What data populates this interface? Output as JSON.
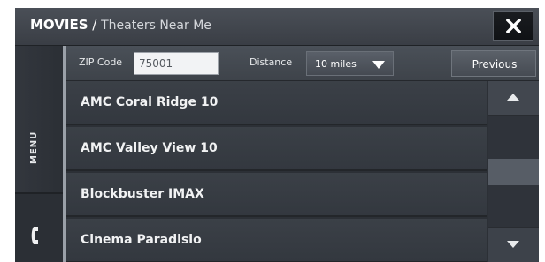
{
  "header": {
    "title_app": "MOVIES",
    "title_separator": " / ",
    "title_page": "Theaters Near Me",
    "close_icon": "close-icon"
  },
  "rail": {
    "menu_label": "MENU",
    "phone_icon": "phone-icon"
  },
  "filters": {
    "zip_label": "ZIP Code",
    "zip_value": "75001",
    "distance_label": "Distance",
    "distance_value": "10 miles",
    "previous_label": "Previous"
  },
  "theaters": [
    {
      "name": "AMC Coral Ridge 10"
    },
    {
      "name": "AMC Valley View 10"
    },
    {
      "name": "Blockbuster IMAX"
    },
    {
      "name": "Cinema Paradisio"
    }
  ],
  "scrollbar": {
    "up_icon": "chevron-up-icon",
    "down_icon": "chevron-down-icon"
  },
  "colors": {
    "background": "#2c3036",
    "header": "#43474e",
    "text": "#ffffff",
    "rail_edge": "#9aa0a8"
  }
}
